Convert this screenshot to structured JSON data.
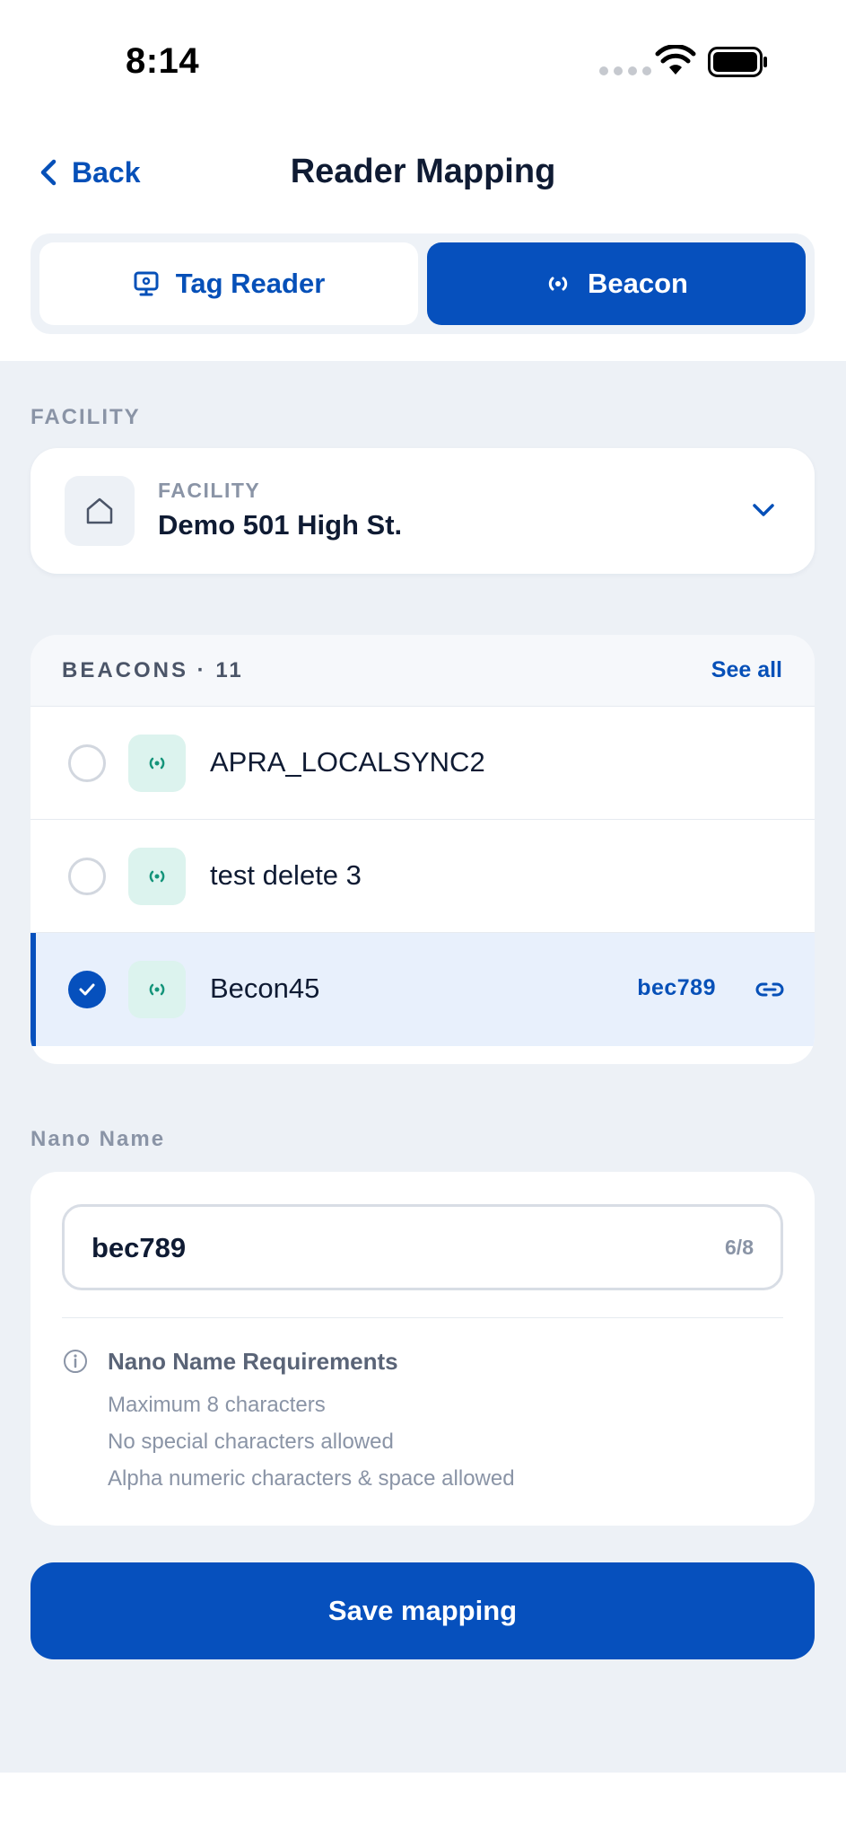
{
  "status_bar": {
    "time": "8:14"
  },
  "nav": {
    "back_label": "Back",
    "title": "Reader Mapping"
  },
  "segments": [
    {
      "label": "Tag Reader",
      "icon": "monitor-icon",
      "active": false
    },
    {
      "label": "Beacon",
      "icon": "broadcast-icon",
      "active": true
    }
  ],
  "facility": {
    "section_label": "FACILITY",
    "field_label": "FACILITY",
    "value": "Demo 501 High St.",
    "icon": "home-icon"
  },
  "beacons": {
    "title": "BEACONS · 11",
    "see_all": "See all",
    "items": [
      {
        "name": "APRA_LOCALSYNC2",
        "selected": false,
        "tag": ""
      },
      {
        "name": "test delete 3",
        "selected": false,
        "tag": ""
      },
      {
        "name": "Becon45",
        "selected": true,
        "tag": "bec789"
      }
    ]
  },
  "nano": {
    "section_label": "Nano Name",
    "value": "bec789",
    "counter": "6/8",
    "requirements_title": "Nano Name Requirements",
    "requirements": [
      "Maximum 8 characters",
      "No special characters allowed",
      "Alpha numeric characters & space allowed"
    ]
  },
  "save_label": "Save mapping",
  "colors": {
    "primary": "#0650bd",
    "background": "#edf1f6",
    "selected_row": "#e8f0fc",
    "beacon_icon_bg": "#dcf3ee",
    "beacon_icon": "#14947a"
  }
}
